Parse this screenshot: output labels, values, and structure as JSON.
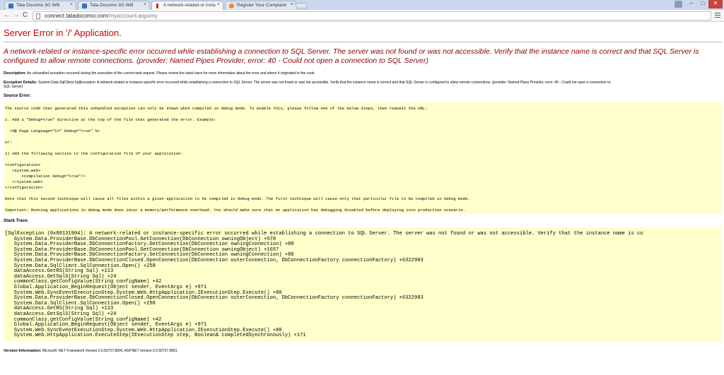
{
  "browser": {
    "tabs": [
      {
        "title": "Tata Docomo 3G Wifi",
        "favicon_color": "#3b6fc4",
        "active": false
      },
      {
        "title": "Tata Docomo 3G Wifi",
        "favicon_color": "#3b6fc4",
        "active": false
      },
      {
        "title": "A network-related or insta",
        "favicon_color": "#cc2222",
        "active": true
      },
      {
        "title": "Register Your Complaint",
        "favicon_color": "#f08a24",
        "active": false
      }
    ],
    "close_glyph": "×",
    "window_controls": {
      "minimize": "–",
      "maximize": "□",
      "close": "✕"
    },
    "nav": {
      "back": "←",
      "forward": "→",
      "reload": "C"
    },
    "url_host": "connect.tatadocomo.com",
    "url_path": "/myaccount.aspxmy"
  },
  "page": {
    "title": "Server Error in '/' Application.",
    "error_heading": "A network-related or instance-specific error occurred while establishing a connection to SQL Server. The server was not found or was not accessible. Verify that the instance name is correct and that SQL Server is configured to allow remote connections. (provider: Named Pipes Provider, error: 40 - Could not open a connection to SQL Server)",
    "description_label": "Description:",
    "description_text": "An unhandled exception occurred during the execution of the current web request. Please review the stack trace for more information about the error and where it originated in the code.",
    "exception_label": "Exception Details:",
    "exception_text_line1": "System.Data.SqlClient.SqlException: A network-related or instance-specific error occurred while establishing a connection to SQL Server. The server was not found or was not accessible. Verify that the instance name is correct and that SQL Server is configured to allow remote connections. (provider: Named Pipes Provider, error: 40 - Could not open a connection to",
    "exception_text_line2": "SQL Server)",
    "source_error_label": "Source Error:",
    "source_error_text": "The source code that generated this unhandled exception can only be shown when compiled in debug mode. To enable this, please follow one of the below steps, then request the URL:\n\n1. Add a \"Debug=true\" directive at the top of the file that generated the error. Example:\n\n  <%@ Page Language=\"C#\" Debug=\"true\" %>\n\nor:\n\n2) Add the following section to the configuration file of your application:\n\n<configuration>\n   <system.web>\n       <compilation debug=\"true\"/>\n   </system.web>\n</configuration>\n\nNote that this second technique will cause all files within a given application to be compiled in debug mode. The first technique will cause only that particular file to be compiled in debug mode.\n\nImportant: Running applications in debug mode does incur a memory/performance overhead. You should make sure that an application has debugging disabled before deploying into production scenario.",
    "stack_trace_label": "Stack Trace:",
    "stack_trace_text": "[SqlException (0x80131904): A network-related or instance-specific error occurred while establishing a connection to SQL Server. The server was not found or was not accessible. Verify that the instance name is co\n   System.Data.ProviderBase.DbConnectionPool.GetConnection(DbConnection owningObject) +578\n   System.Data.ProviderBase.DbConnectionFactory.GetConnection(DbConnection owningConnection) +88\n   System.Data.ProviderBase.DbConnectionPool.GetConnection(DbConnection owningObject) +1657\n   System.Data.ProviderBase.DbConnectionFactory.GetConnection(DbConnection owningConnection) +88\n   System.Data.ProviderBase.DbConnectionClosed.OpenConnection(DbConnection outerConnection, DbConnectionFactory connectionFactory) +6322983\n   System.Data.SqlClient.SqlConnection.Open() +258\n   dataAccess.GetRS(String Sql) +113\n   dataAccess.GetSqlS(String Sql) +24\n   commonClass.getConfigValue(String configName) +42\n   Global.Application_BeginRequest(Object sender, EventArgs e) +971\n   System.Web.SyncEventExecutionStep.System.Web.HttpApplication.IExecutionStep.Execute() +80\n   System.Data.ProviderBase.DbConnectionClosed.OpenConnection(DbConnection outerConnection, DbConnectionFactory connectionFactory) +6322983\n   System.Data.SqlClient.SqlConnection.Open() +258\n   dataAccess.GetRS(String Sql) +113\n   dataAccess.GetSqlS(String Sql) +24\n   commonClass.getConfigValue(String configName) +42\n   Global.Application_BeginRequest(Object sender, EventArgs e) +971\n   System.Web.SyncEventExecutionStep.System.Web.HttpApplication.IExecutionStep.Execute() +80\n   System.Web.HttpApplication.ExecuteStep(IExecutionStep step, Boolean& completedSynchronously) +171",
    "version_label": "Version Information:",
    "version_text": "Microsoft .NET Framework Version:2.0.50727.8000; ASP.NET Version:2.0.50727.8001"
  }
}
